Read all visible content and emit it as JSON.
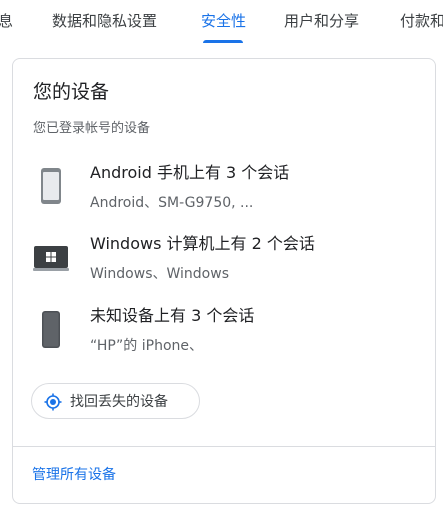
{
  "tabs": [
    {
      "label": "息"
    },
    {
      "label": "数据和隐私设置"
    },
    {
      "label": "安全性",
      "active": true
    },
    {
      "label": "用户和分享"
    },
    {
      "label": "付款和"
    }
  ],
  "card": {
    "title": "您的设备",
    "subtitle": "您已登录帐号的设备",
    "devices": [
      {
        "icon": "phone-icon",
        "title": "Android 手机上有 3 个会话",
        "subtitle": "Android、SM-G9750, ..."
      },
      {
        "icon": "windows-laptop-icon",
        "title": "Windows 计算机上有 2 个会话",
        "subtitle": "Windows、Windows"
      },
      {
        "icon": "phone-dark-icon",
        "title": "未知设备上有 3 个会话",
        "subtitle": "“HP”的 iPhone、"
      }
    ],
    "find_button": {
      "label": "找回丢失的设备",
      "icon": "location-target-icon"
    },
    "manage_link": "管理所有设备"
  },
  "colors": {
    "accent": "#1a73e8",
    "text_primary": "#202124",
    "text_secondary": "#5f6368",
    "border": "#dadce0"
  }
}
